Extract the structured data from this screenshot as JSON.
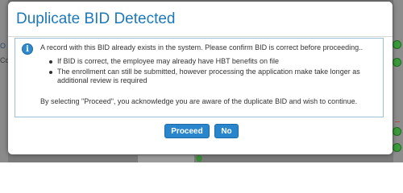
{
  "background": {
    "left_text_1": "O",
    "left_text_2": "Co"
  },
  "modal": {
    "title": "Duplicate BID Detected",
    "info_icon": "info-icon",
    "message": "A record with this BID already exists in the system. Please confirm BID is correct before proceeding..",
    "bullets": [
      "If BID is correct, the employee may already have HBT benefits on file",
      "The enrollment can still be submitted, however processing the application make take longer as additional review is required"
    ],
    "acknowledgement": "By selecting \"Proceed\", you acknowledge you are aware of the duplicate BID and wish to continue.",
    "buttons": {
      "proceed_label": "Proceed",
      "no_label": "No"
    }
  },
  "colors": {
    "title": "#1d78b8",
    "button": "#2a86cc",
    "info_border": "#9cbfd6",
    "overlay": "#7a7a7a"
  }
}
